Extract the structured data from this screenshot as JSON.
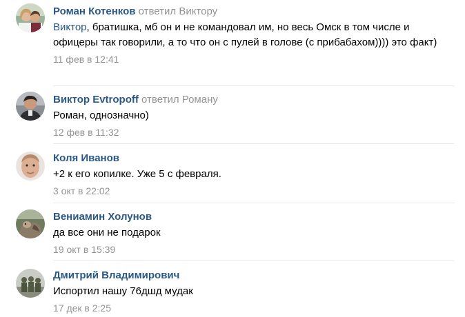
{
  "comments": [
    {
      "author": "Роман Котенков",
      "reply_label": "ответил Виктору",
      "mention": "Виктор",
      "text": ", братишка, мб он и не командовал им, но весь Омск в том числе и офицеры так говорили, а то что он с пулей в голове (с прибабахом)))) это факт)",
      "date": "11 фев в 12:41",
      "avatar": "avatar-couple-photo"
    },
    {
      "author": "Виктор Evtropoff",
      "reply_label": "ответил Роману",
      "mention": "",
      "text": "Роман, однозначно)",
      "date": "12 фев в 11:32",
      "avatar": "avatar-man-photo"
    },
    {
      "author": "Коля Иванов",
      "reply_label": "",
      "mention": "",
      "text": "+2 к его копилке. Уже 5 с февраля.",
      "date": "3 окт в 22:02",
      "avatar": "avatar-face-photo"
    },
    {
      "author": "Вениамин Холунов",
      "reply_label": "",
      "mention": "",
      "text": "да все они не подарок",
      "date": "19 окт в 15:39",
      "avatar": "avatar-animal-photo"
    },
    {
      "author": "Дмитрий Владимирович",
      "reply_label": "",
      "mention": "",
      "text": "Испортил нашу 76дшд мудак",
      "date": "17 дек в 2:25",
      "avatar": "avatar-soldiers-photo"
    }
  ],
  "colors": {
    "link": "#2a5885",
    "meta": "#939393",
    "divider": "#e7e8ec"
  }
}
